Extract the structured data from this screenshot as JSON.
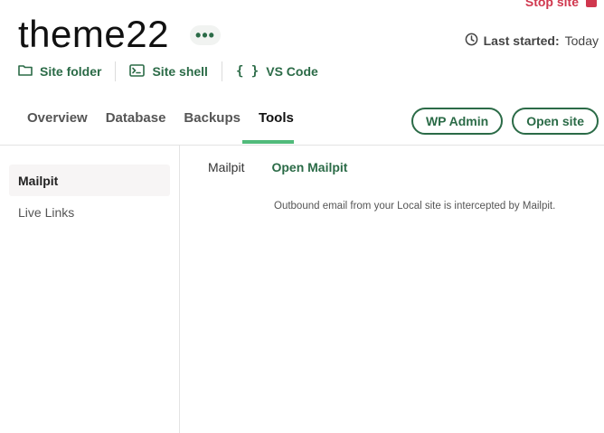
{
  "header": {
    "stop_site_label": "Stop site",
    "site_name": "theme22",
    "more_label": "•••",
    "last_started_label": "Last started:",
    "last_started_value": "Today"
  },
  "quick_links": [
    {
      "label": "Site folder",
      "icon": "folder-icon"
    },
    {
      "label": "Site shell",
      "icon": "terminal-icon"
    },
    {
      "label": "VS Code",
      "icon": "braces-icon"
    }
  ],
  "tabs": [
    {
      "label": "Overview",
      "active": false
    },
    {
      "label": "Database",
      "active": false
    },
    {
      "label": "Backups",
      "active": false
    },
    {
      "label": "Tools",
      "active": true
    }
  ],
  "actions": {
    "wp_admin_label": "WP Admin",
    "open_site_label": "Open site"
  },
  "sidebar": {
    "items": [
      {
        "label": "Mailpit",
        "active": true
      },
      {
        "label": "Live Links",
        "active": false
      }
    ]
  },
  "tool": {
    "name": "Mailpit",
    "action_label": "Open Mailpit",
    "description": "Outbound email from your Local site is intercepted by Mailpit."
  },
  "colors": {
    "accent_green": "#2b6b47",
    "tab_underline": "#51bb7b",
    "stop_red": "#d0374e"
  }
}
